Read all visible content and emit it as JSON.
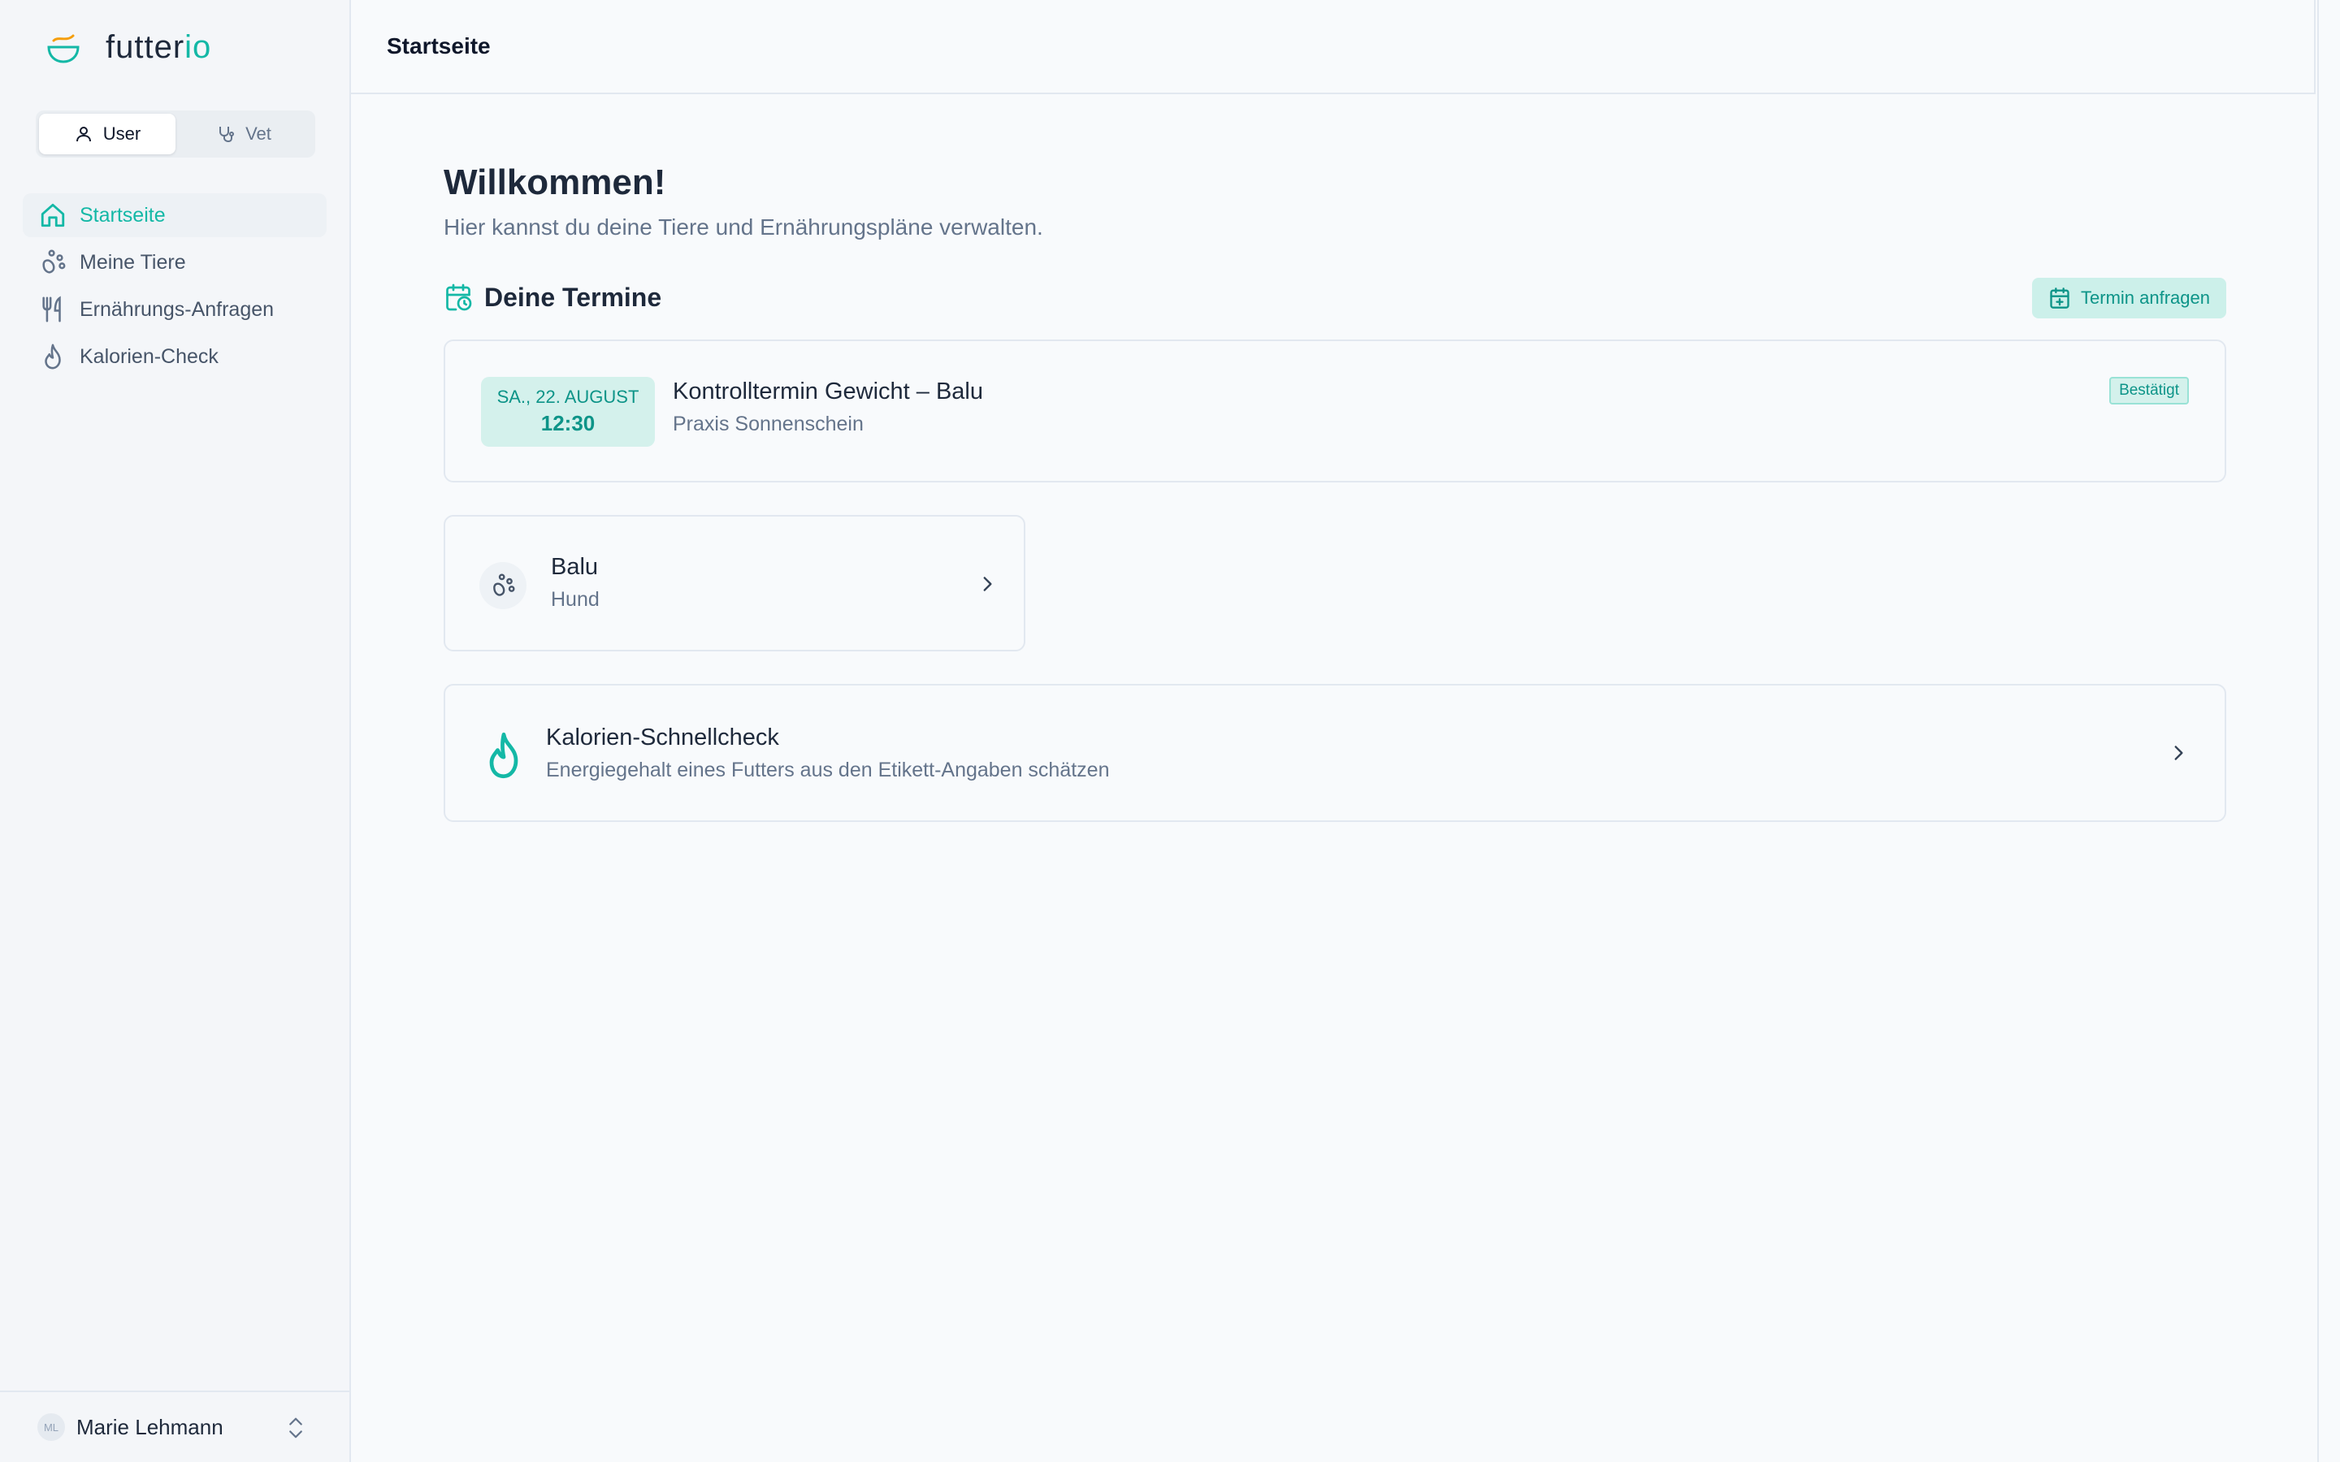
{
  "brand": {
    "name_main": "futter",
    "name_accent": "io",
    "icon": "bowl-logo-icon"
  },
  "role_switch": {
    "user_label": "User",
    "vet_label": "Vet",
    "selected": "User"
  },
  "nav": {
    "items": [
      {
        "label": "Startseite",
        "icon": "home-icon",
        "active": true
      },
      {
        "label": "Meine Tiere",
        "icon": "paw-icon",
        "active": false
      },
      {
        "label": "Ernährungs-Anfragen",
        "icon": "utensils-icon",
        "active": false
      },
      {
        "label": "Kalorien-Check",
        "icon": "flame-icon",
        "active": false
      }
    ]
  },
  "user": {
    "initials": "ML",
    "name": "Marie Lehmann"
  },
  "header": {
    "title": "Startseite"
  },
  "welcome": {
    "title": "Willkommen!",
    "subtitle": "Hier kannst du deine Tiere und Ernährungspläne verwalten."
  },
  "appointments": {
    "section_title": "Deine Termine",
    "request_label": "Termin anfragen",
    "items": [
      {
        "date": "SA., 22. AUGUST",
        "time": "12:30",
        "title": "Kontrolltermin Gewicht – Balu",
        "place": "Praxis Sonnenschein",
        "status": "Bestätigt"
      }
    ]
  },
  "pets": [
    {
      "name": "Balu",
      "species": "Hund"
    }
  ],
  "calorie_check": {
    "title": "Kalorien-Schnellcheck",
    "description": "Energiegehalt eines Futters aus den Etikett-Angaben schätzen"
  },
  "colors": {
    "accent": "#14b8a6",
    "accent_bg": "#ccf0ea",
    "text": "#1e293b",
    "muted": "#64748b"
  }
}
